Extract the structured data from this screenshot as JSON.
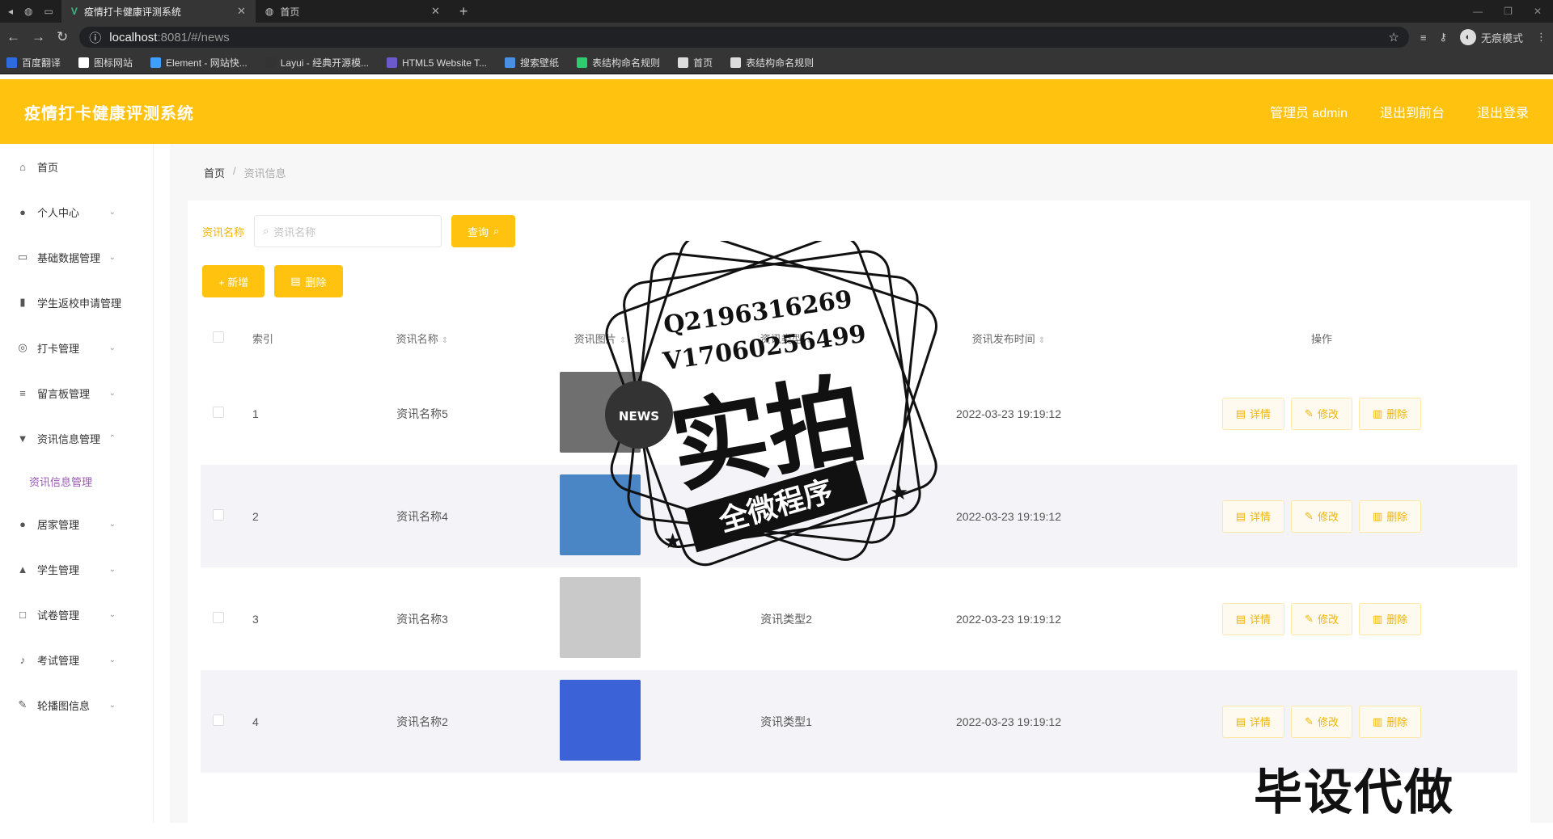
{
  "browser": {
    "tabs": [
      {
        "title": "疫情打卡健康评测系统",
        "active": true
      },
      {
        "title": "首页",
        "active": false
      }
    ],
    "url_host": "localhost",
    "url_path": ":8081/#/news",
    "incognito_label": "无痕模式",
    "bookmarks": [
      {
        "label": "百度翻译",
        "color": "#2d6cdf"
      },
      {
        "label": "图标网站",
        "color": "#ffffff"
      },
      {
        "label": "Element - 网站快...",
        "color": "#409eff"
      },
      {
        "label": "Layui - 经典开源模...",
        "color": "#333333"
      },
      {
        "label": "HTML5 Website T...",
        "color": "#6a5acd"
      },
      {
        "label": "搜索壁纸",
        "color": "#4a90e2"
      },
      {
        "label": "表结构命名规则",
        "color": "#2ecc71"
      },
      {
        "label": "首页",
        "color": "#dddddd"
      },
      {
        "label": "表结构命名规则",
        "color": "#dddddd"
      }
    ]
  },
  "header": {
    "title": "疫情打卡健康评测系统",
    "links": [
      "管理员 admin",
      "退出到前台",
      "退出登录"
    ]
  },
  "sidebar": {
    "items": [
      {
        "label": "首页",
        "icon": "home-icon",
        "glyph": "⌂",
        "chev": ""
      },
      {
        "label": "个人中心",
        "icon": "user-icon",
        "glyph": "●",
        "chev": "⌄"
      },
      {
        "label": "基础数据管理",
        "icon": "form-icon",
        "glyph": "▭",
        "chev": "⌄"
      },
      {
        "label": "学生返校申请管理",
        "icon": "chart-icon",
        "glyph": "▮",
        "chev": "⌄"
      },
      {
        "label": "打卡管理",
        "icon": "compass-icon",
        "glyph": "◎",
        "chev": "⌄"
      },
      {
        "label": "留言板管理",
        "icon": "sliders-icon",
        "glyph": "≡",
        "chev": "⌄"
      },
      {
        "label": "资讯信息管理",
        "icon": "message-icon",
        "glyph": "▼",
        "chev": "⌃"
      }
    ],
    "submenu": {
      "label": "资讯信息管理"
    },
    "items2": [
      {
        "label": "居家管理",
        "icon": "user-icon",
        "glyph": "●",
        "chev": "⌄"
      },
      {
        "label": "学生管理",
        "icon": "thumb-icon",
        "glyph": "▲",
        "chev": "⌄"
      },
      {
        "label": "试卷管理",
        "icon": "crop-icon",
        "glyph": "□",
        "chev": "⌄"
      },
      {
        "label": "考试管理",
        "icon": "mic-icon",
        "glyph": "♪",
        "chev": "⌄"
      },
      {
        "label": "轮播图信息",
        "icon": "edit-icon",
        "glyph": "✎",
        "chev": "⌄"
      }
    ]
  },
  "breadcrumb": {
    "home": "首页",
    "sep": "/",
    "current": "资讯信息"
  },
  "search": {
    "label": "资讯名称",
    "placeholder": "资讯名称",
    "button": "查询"
  },
  "actions": {
    "add": "+ 新增",
    "delete": "删除"
  },
  "table": {
    "headers": {
      "index": "索引",
      "name": "资讯名称",
      "image": "资讯图片",
      "type": "资讯类型",
      "time": "资讯发布时间",
      "ops": "操作"
    },
    "op_labels": {
      "detail": "详情",
      "edit": "修改",
      "delete": "删除"
    },
    "rows": [
      {
        "index": "1",
        "name": "资讯名称5",
        "type": "",
        "time": "2022-03-23 19:19:12",
        "img": "#6f6f6f"
      },
      {
        "index": "2",
        "name": "资讯名称4",
        "type": "",
        "time": "2022-03-23 19:19:12",
        "img": "#4a86c5"
      },
      {
        "index": "3",
        "name": "资讯名称3",
        "type": "资讯类型2",
        "time": "2022-03-23 19:19:12",
        "img": "#c9c9c9"
      },
      {
        "index": "4",
        "name": "资讯名称2",
        "type": "资讯类型1",
        "time": "2022-03-23 19:19:12",
        "img": "#3b62d6"
      }
    ]
  },
  "watermark": {
    "qq": "Q2196316269",
    "vx": "V17060256499",
    "big": "实拍",
    "band": "全微程序",
    "badge": "NEWS",
    "corner": "毕设代做"
  }
}
